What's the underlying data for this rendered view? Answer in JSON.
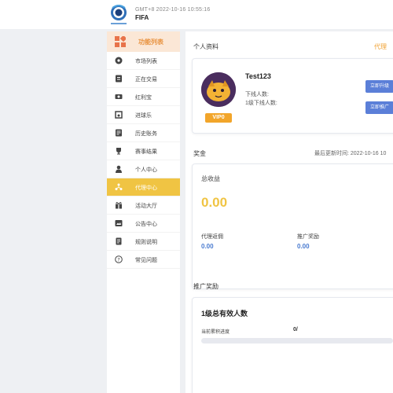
{
  "header": {
    "timezone_time": "GMT+8   2022-10-16 10:55:16",
    "brand": "FIFA"
  },
  "sidebar": {
    "title": "功能列表",
    "active_index": 7,
    "items": [
      {
        "label": "市场列表",
        "icon": "soccer-ball-icon"
      },
      {
        "label": "正在交易",
        "icon": "trade-icon"
      },
      {
        "label": "红利宝",
        "icon": "dividend-icon"
      },
      {
        "label": "进球乐",
        "icon": "goal-icon"
      },
      {
        "label": "历史账务",
        "icon": "history-icon"
      },
      {
        "label": "赛事结果",
        "icon": "trophy-icon"
      },
      {
        "label": "个人中心",
        "icon": "user-icon"
      },
      {
        "label": "代理中心",
        "icon": "agent-icon"
      },
      {
        "label": "活动大厅",
        "icon": "gift-icon"
      },
      {
        "label": "公告中心",
        "icon": "notice-icon"
      },
      {
        "label": "规则说明",
        "icon": "rules-icon"
      },
      {
        "label": "常见问题",
        "icon": "question-icon"
      }
    ]
  },
  "profile": {
    "section_title": "个人资料",
    "agent_link": "代理",
    "username": "Test123",
    "downline_label": "下线人数:",
    "level1_label": "1级下线人数:",
    "vip": "VIP0",
    "upgrade_button": "立即升级",
    "promote_button": "立即推广"
  },
  "bonus": {
    "section_title": "奖金",
    "update_time": "最后更新时间: 2022-10-16 10",
    "total_label": "总收益",
    "total_value": "0.00",
    "rebate_label": "代理返佣",
    "rebate_value": "0.00",
    "reward_label": "推广奖励",
    "reward_value": "0.00"
  },
  "promo": {
    "section_title": "推广奖励",
    "effective_title": "1级总有效人数",
    "progress_label": "当前累积进度",
    "progress_value": "0/",
    "progress_fraction": 0
  },
  "colors": {
    "accent": "#f0c443",
    "link_blue": "#4a7bd0",
    "button_blue": "#5b7fd8",
    "vip_orange": "#f2a52a"
  }
}
